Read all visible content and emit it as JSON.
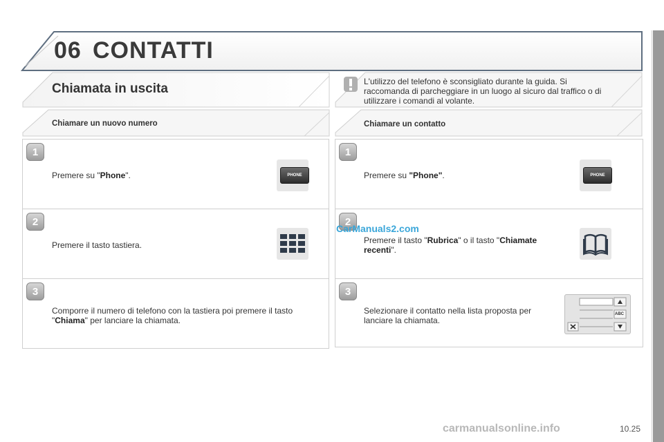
{
  "header": {
    "chapter_number": "06",
    "chapter_title": "CONTATTI"
  },
  "section": {
    "title": "Chiamata in uscita"
  },
  "warning": {
    "icon": "exclamation-icon",
    "text": "L'utilizzo del telefono è sconsigliato durante la guida. Si raccomanda di parcheggiare in un luogo al sicuro dal traffico o di utilizzare i comandi al volante."
  },
  "left": {
    "subtitle": "Chiamare un nuovo numero",
    "steps": [
      {
        "number": "1",
        "text_before": "Premere su \"",
        "bold": "Phone",
        "text_after": "\".",
        "icon": "phone-button-icon",
        "icon_label": "PHONE"
      },
      {
        "number": "2",
        "text": "Premere il tasto tastiera.",
        "icon": "keypad-icon"
      },
      {
        "number": "3",
        "text_before": "Comporre il numero di telefono con la tastiera poi premere il tasto \"",
        "bold": "Chiama",
        "text_after": "\" per lanciare la chiamata."
      }
    ]
  },
  "right": {
    "subtitle": "Chiamare un contatto",
    "steps": [
      {
        "number": "1",
        "text_before": "Premere su ",
        "bold": "\"Phone\"",
        "text_after": ".",
        "icon": "phone-button-icon",
        "icon_label": "PHONE"
      },
      {
        "number": "2",
        "text_before": "Premere il tasto \"",
        "bold": "Rubrica",
        "text_mid": "\" o il tasto \"",
        "bold2": "Chiamate recenti",
        "text_after": "\".",
        "icon": "book-icon"
      },
      {
        "number": "3",
        "text": "Selezionare il contatto nella lista proposta per lanciare la chiamata.",
        "icon": "contact-list-icon",
        "list_button_label": "ABC"
      }
    ]
  },
  "watermark": "CarManuals2.com",
  "footer": {
    "page_number": "10.25",
    "url": "carmanualsonline.info"
  },
  "colors": {
    "accent_watermark": "#3aa6d9",
    "panel_border": "#cfcfcf",
    "sidebar": "#9a9a9a"
  }
}
